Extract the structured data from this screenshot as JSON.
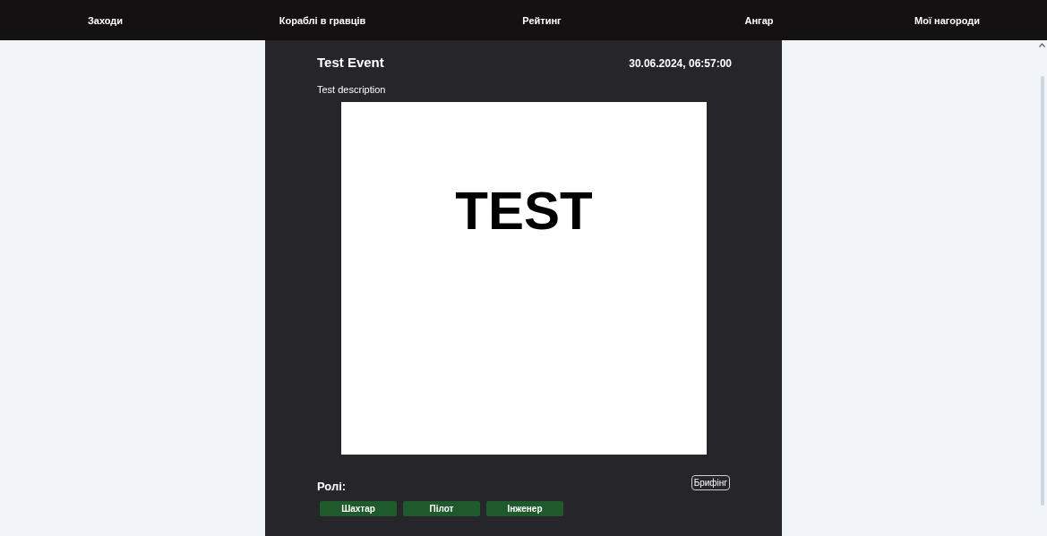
{
  "nav": [
    {
      "label": "Заходи"
    },
    {
      "label": "Кораблі в гравців"
    },
    {
      "label": "Рейтинг"
    },
    {
      "label": "Ангар"
    },
    {
      "label": "Мої нагороди"
    }
  ],
  "event": {
    "title": "Test Event",
    "date": "30.06.2024, 06:57:00",
    "description": "Test description",
    "image": {
      "text": "TEST"
    },
    "roles_label": "Ролі:",
    "briefing_button": "Брифінг",
    "roles": [
      {
        "label": "Шахтар"
      },
      {
        "label": "Пілот"
      },
      {
        "label": "Інженер"
      }
    ]
  }
}
